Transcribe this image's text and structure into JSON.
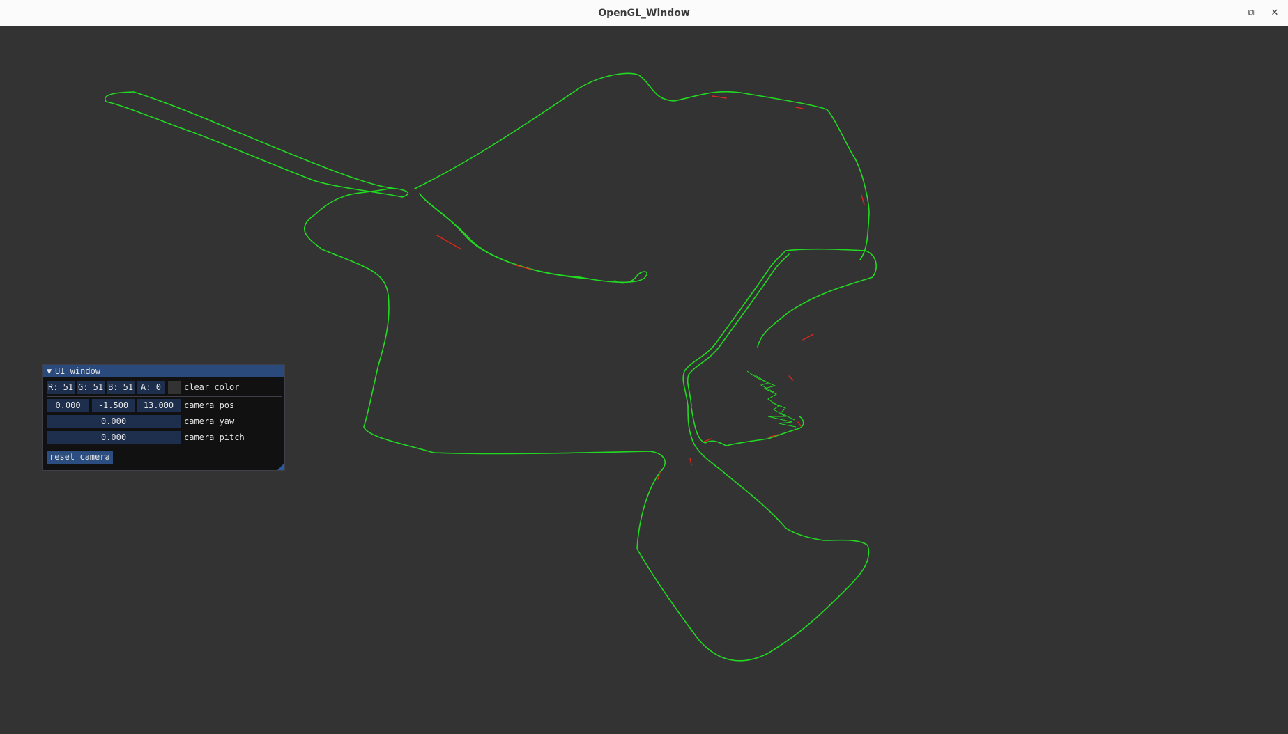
{
  "window": {
    "title": "OpenGL_Window",
    "minimize_icon": "minimize-icon",
    "restore_icon": "restore-icon",
    "close_icon": "close-icon"
  },
  "scene": {
    "clear_color": "#333333",
    "trajectory_color": "#22d922",
    "error_color": "#e0261a"
  },
  "ui_window": {
    "title": "UI window",
    "collapse_icon": "triangle-down-icon",
    "clear_color": {
      "r": "R: 51",
      "g": "G: 51",
      "b": "B: 51",
      "a": "A:  0",
      "label": "clear color"
    },
    "camera_pos": {
      "x": "0.000",
      "y": "-1.500",
      "z": "13.000",
      "label": "camera pos"
    },
    "camera_yaw": {
      "value": "0.000",
      "label": "camera yaw"
    },
    "camera_pitch": {
      "value": "0.000",
      "label": "camera pitch"
    },
    "reset_button": "reset camera"
  }
}
